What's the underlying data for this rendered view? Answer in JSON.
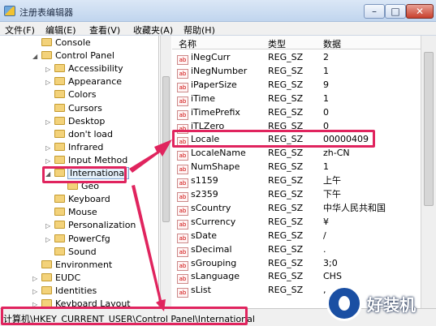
{
  "window": {
    "title": "注册表编辑器",
    "minimize_glyph": "–",
    "maximize_glyph": "□",
    "close_glyph": "✕"
  },
  "menu": [
    "文件(F)",
    "编辑(E)",
    "查看(V)",
    "收藏夹(A)",
    "帮助(H)"
  ],
  "tree": {
    "items": [
      {
        "label": "Console",
        "has_arrow": false,
        "selected": false
      },
      {
        "label": "Control Panel",
        "has_arrow": true,
        "expanded": true,
        "selected": false
      },
      {
        "label": "Accessibility",
        "has_arrow": true,
        "selected": false
      },
      {
        "label": "Appearance",
        "has_arrow": true,
        "selected": false
      },
      {
        "label": "Colors",
        "has_arrow": false,
        "selected": false
      },
      {
        "label": "Cursors",
        "has_arrow": false,
        "selected": false
      },
      {
        "label": "Desktop",
        "has_arrow": true,
        "selected": false
      },
      {
        "label": "don't load",
        "has_arrow": false,
        "selected": false
      },
      {
        "label": "Infrared",
        "has_arrow": true,
        "selected": false
      },
      {
        "label": "Input Method",
        "has_arrow": true,
        "selected": false
      },
      {
        "label": "International",
        "has_arrow": true,
        "expanded": true,
        "selected": true
      },
      {
        "label": "Geo",
        "has_arrow": false,
        "selected": false
      },
      {
        "label": "Keyboard",
        "has_arrow": false,
        "selected": false
      },
      {
        "label": "Mouse",
        "has_arrow": false,
        "selected": false
      },
      {
        "label": "Personalization",
        "has_arrow": true,
        "selected": false
      },
      {
        "label": "PowerCfg",
        "has_arrow": true,
        "selected": false
      },
      {
        "label": "Sound",
        "has_arrow": false,
        "selected": false
      },
      {
        "label": "Environment",
        "has_arrow": false,
        "selected": false
      },
      {
        "label": "EUDC",
        "has_arrow": true,
        "selected": false
      },
      {
        "label": "Identities",
        "has_arrow": true,
        "selected": false
      },
      {
        "label": "Keyboard Layout",
        "has_arrow": true,
        "selected": false
      }
    ]
  },
  "values_panel": {
    "headers": {
      "name": "名称",
      "type": "类型",
      "data": "数据"
    },
    "icon_text": "ab",
    "rows": [
      {
        "name": "iNegCurr",
        "type": "REG_SZ",
        "data": "2"
      },
      {
        "name": "iNegNumber",
        "type": "REG_SZ",
        "data": "1"
      },
      {
        "name": "iPaperSize",
        "type": "REG_SZ",
        "data": "9"
      },
      {
        "name": "iTime",
        "type": "REG_SZ",
        "data": "1"
      },
      {
        "name": "iTimePrefix",
        "type": "REG_SZ",
        "data": "0"
      },
      {
        "name": "iTLZero",
        "type": "REG_SZ",
        "data": "0"
      },
      {
        "name": "Locale",
        "type": "REG_SZ",
        "data": "00000409"
      },
      {
        "name": "LocaleName",
        "type": "REG_SZ",
        "data": "zh-CN"
      },
      {
        "name": "NumShape",
        "type": "REG_SZ",
        "data": "1"
      },
      {
        "name": "s1159",
        "type": "REG_SZ",
        "data": "上午"
      },
      {
        "name": "s2359",
        "type": "REG_SZ",
        "data": "下午"
      },
      {
        "name": "sCountry",
        "type": "REG_SZ",
        "data": "中华人民共和国"
      },
      {
        "name": "sCurrency",
        "type": "REG_SZ",
        "data": "¥"
      },
      {
        "name": "sDate",
        "type": "REG_SZ",
        "data": "/"
      },
      {
        "name": "sDecimal",
        "type": "REG_SZ",
        "data": "."
      },
      {
        "name": "sGrouping",
        "type": "REG_SZ",
        "data": "3;0"
      },
      {
        "name": "sLanguage",
        "type": "REG_SZ",
        "data": "CHS"
      },
      {
        "name": "sList",
        "type": "REG_SZ",
        "data": ","
      }
    ]
  },
  "status_bar": {
    "path": "计算机\\HKEY_CURRENT_USER\\Control Panel\\International"
  },
  "annotation": {
    "highlight_color": "#e0245e"
  },
  "watermark": {
    "text": "好装机"
  }
}
